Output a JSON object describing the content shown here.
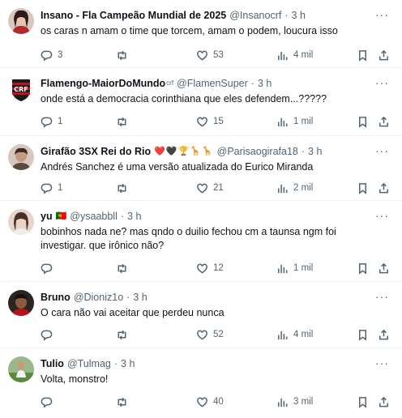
{
  "replies": [
    {
      "name": "Insano - Fla Campeão Mundial de 2025",
      "handle": "@Insanocrf",
      "time": "3 h",
      "text": "os caras n amam o time que torcem, amam o podem, loucura isso",
      "reply_count": "3",
      "retweet_count": "",
      "like_count": "53",
      "view_count": "4 mil",
      "avatar_color": "#c9a592"
    },
    {
      "name": "Flamengo-MaiorDoMundo",
      "name_suffix": "crf",
      "handle": "@FlamenSuper",
      "time": "3 h",
      "text": "onde está a democracia corinthiana que eles defendem...?????",
      "reply_count": "1",
      "retweet_count": "",
      "like_count": "15",
      "view_count": "1 mil",
      "avatar_color": "#c1121f"
    },
    {
      "name": "Girafão 3SX Rei do Rio",
      "emojis": "❤️🖤🏆🦒🦒",
      "handle": "@Parisaogirafa18",
      "time": "3 h",
      "text": "Andrés Sanchez é uma versão atualizada do Eurico Miranda",
      "reply_count": "1",
      "retweet_count": "",
      "like_count": "21",
      "view_count": "2 mil",
      "avatar_color": "#8a6d5b"
    },
    {
      "name": "yu",
      "flag": "🇵🇹",
      "handle": "@ysaabbll",
      "time": "3 h",
      "text": "bobinhos nada ne? mas qndo o duilio fechou cm a taunsa ngm foi investigar. que irônico não?",
      "reply_count": "",
      "retweet_count": "",
      "like_count": "12",
      "view_count": "1 mil",
      "avatar_color": "#d8c3bb"
    },
    {
      "name": "Bruno",
      "handle": "@Dioniz1o",
      "time": "3 h",
      "text": "O cara não vai aceitar que perdeu nunca",
      "reply_count": "",
      "retweet_count": "",
      "like_count": "52",
      "view_count": "4 mil",
      "avatar_color": "#3a3430"
    },
    {
      "name": "Tulio",
      "handle": "@Tulmag",
      "time": "3 h",
      "text": "Volta, monstro!",
      "reply_count": "",
      "retweet_count": "",
      "like_count": "40",
      "view_count": "3 mil",
      "avatar_color": "#6f8f5c"
    }
  ]
}
